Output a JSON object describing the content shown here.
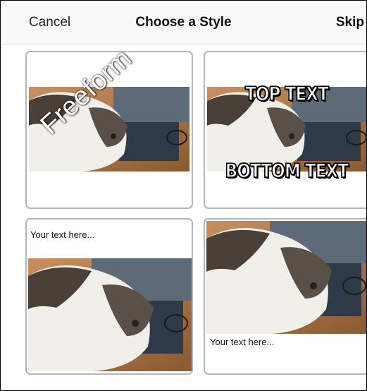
{
  "navbar": {
    "cancel_label": "Cancel",
    "title": "Choose a Style",
    "skip_label": "Skip"
  },
  "styles": [
    {
      "name": "freeform",
      "overlay_text": "Freeform"
    },
    {
      "name": "top-bottom",
      "top_text": "TOP TEXT",
      "bottom_text": "BOTTOM TEXT"
    },
    {
      "name": "caption-above",
      "caption": "Your text here..."
    },
    {
      "name": "caption-below",
      "caption": "Your text here..."
    }
  ],
  "colors": {
    "card_border": "#b5b5b5",
    "navbar_bg": "#f9f9f9",
    "meme_text": "#ffffff",
    "meme_outline": "#000000"
  },
  "icons": {
    "photo": "cat-on-laptop-photo"
  }
}
